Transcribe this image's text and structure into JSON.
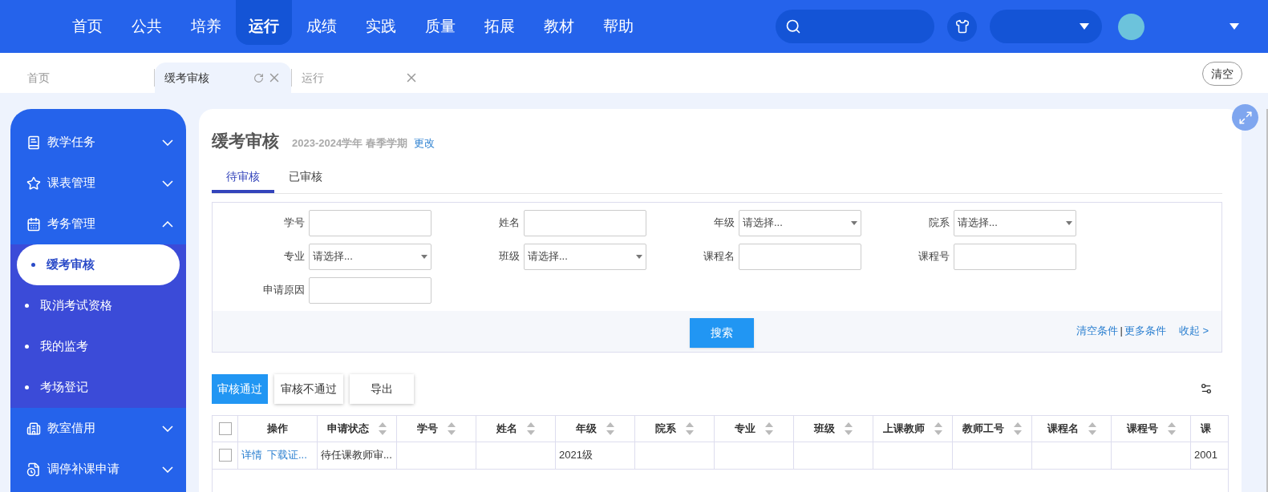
{
  "top_nav": {
    "items": [
      {
        "label": "首页",
        "selected": false
      },
      {
        "label": "公共",
        "selected": false
      },
      {
        "label": "培养",
        "selected": false
      },
      {
        "label": "运行",
        "selected": true
      },
      {
        "label": "成绩",
        "selected": false
      },
      {
        "label": "实践",
        "selected": false
      },
      {
        "label": "质量",
        "selected": false
      },
      {
        "label": "拓展",
        "selected": false
      },
      {
        "label": "教材",
        "selected": false
      },
      {
        "label": "帮助",
        "selected": false
      }
    ]
  },
  "page_tabs": {
    "items": [
      {
        "label": "首页",
        "selected": false,
        "closable": false
      },
      {
        "label": "缓考审核",
        "selected": true,
        "closable": true
      },
      {
        "label": "运行",
        "selected": false,
        "closable": true
      }
    ],
    "clear_button": "清空"
  },
  "sidebar": {
    "items": [
      {
        "label": "教学任务",
        "expanded": false
      },
      {
        "label": "课表管理",
        "expanded": false
      },
      {
        "label": "考务管理",
        "expanded": true,
        "children": [
          {
            "label": "缓考审核",
            "selected": true
          },
          {
            "label": "取消考试资格",
            "selected": false
          },
          {
            "label": "我的监考",
            "selected": false
          },
          {
            "label": "考场登记",
            "selected": false
          }
        ]
      },
      {
        "label": "教室借用",
        "expanded": false
      },
      {
        "label": "调停补课申请",
        "expanded": false
      }
    ]
  },
  "page": {
    "title": "缓考审核",
    "term": "2023-2024学年 春季学期",
    "change_link": "更改",
    "tabs": [
      {
        "label": "待审核",
        "selected": true
      },
      {
        "label": "已审核",
        "selected": false
      }
    ],
    "filters": [
      {
        "label": "学号",
        "kind": "text"
      },
      {
        "label": "姓名",
        "kind": "text"
      },
      {
        "label": "年级",
        "kind": "select",
        "placeholder": "请选择..."
      },
      {
        "label": "院系",
        "kind": "select",
        "placeholder": "请选择..."
      },
      {
        "label": "专业",
        "kind": "select",
        "placeholder": "请选择..."
      },
      {
        "label": "班级",
        "kind": "select",
        "placeholder": "请选择..."
      },
      {
        "label": "课程名",
        "kind": "text"
      },
      {
        "label": "课程号",
        "kind": "text"
      },
      {
        "label": "申请原因",
        "kind": "text"
      }
    ],
    "search_button": "搜索",
    "filter_links": {
      "items": [
        "清空条件",
        "更多条件"
      ],
      "separator": "|"
    },
    "collapse_link": "收起 >",
    "actions": [
      {
        "label": "审核通过",
        "primary": true
      },
      {
        "label": "审核不通过",
        "primary": false
      },
      {
        "label": "导出",
        "primary": false
      }
    ],
    "table": {
      "all_checked": false,
      "columns": [
        {
          "label": "操作",
          "sortable": false
        },
        {
          "label": "申请状态",
          "sortable": true
        },
        {
          "label": "学号",
          "sortable": true
        },
        {
          "label": "姓名",
          "sortable": true
        },
        {
          "label": "年级",
          "sortable": true
        },
        {
          "label": "院系",
          "sortable": true
        },
        {
          "label": "专业",
          "sortable": true
        },
        {
          "label": "班级",
          "sortable": true
        },
        {
          "label": "上课教师",
          "sortable": true
        },
        {
          "label": "教师工号",
          "sortable": true
        },
        {
          "label": "课程名",
          "sortable": true
        },
        {
          "label": "课程号",
          "sortable": true
        },
        {
          "label": "课",
          "sortable": false
        }
      ],
      "rows": [
        {
          "checked": false,
          "cells": [
            {
              "links": [
                "详情",
                "下载证..."
              ]
            },
            "待任课教师审...",
            null,
            null,
            "2021级",
            null,
            null,
            null,
            null,
            null,
            null,
            null,
            "2001"
          ]
        }
      ]
    }
  }
}
